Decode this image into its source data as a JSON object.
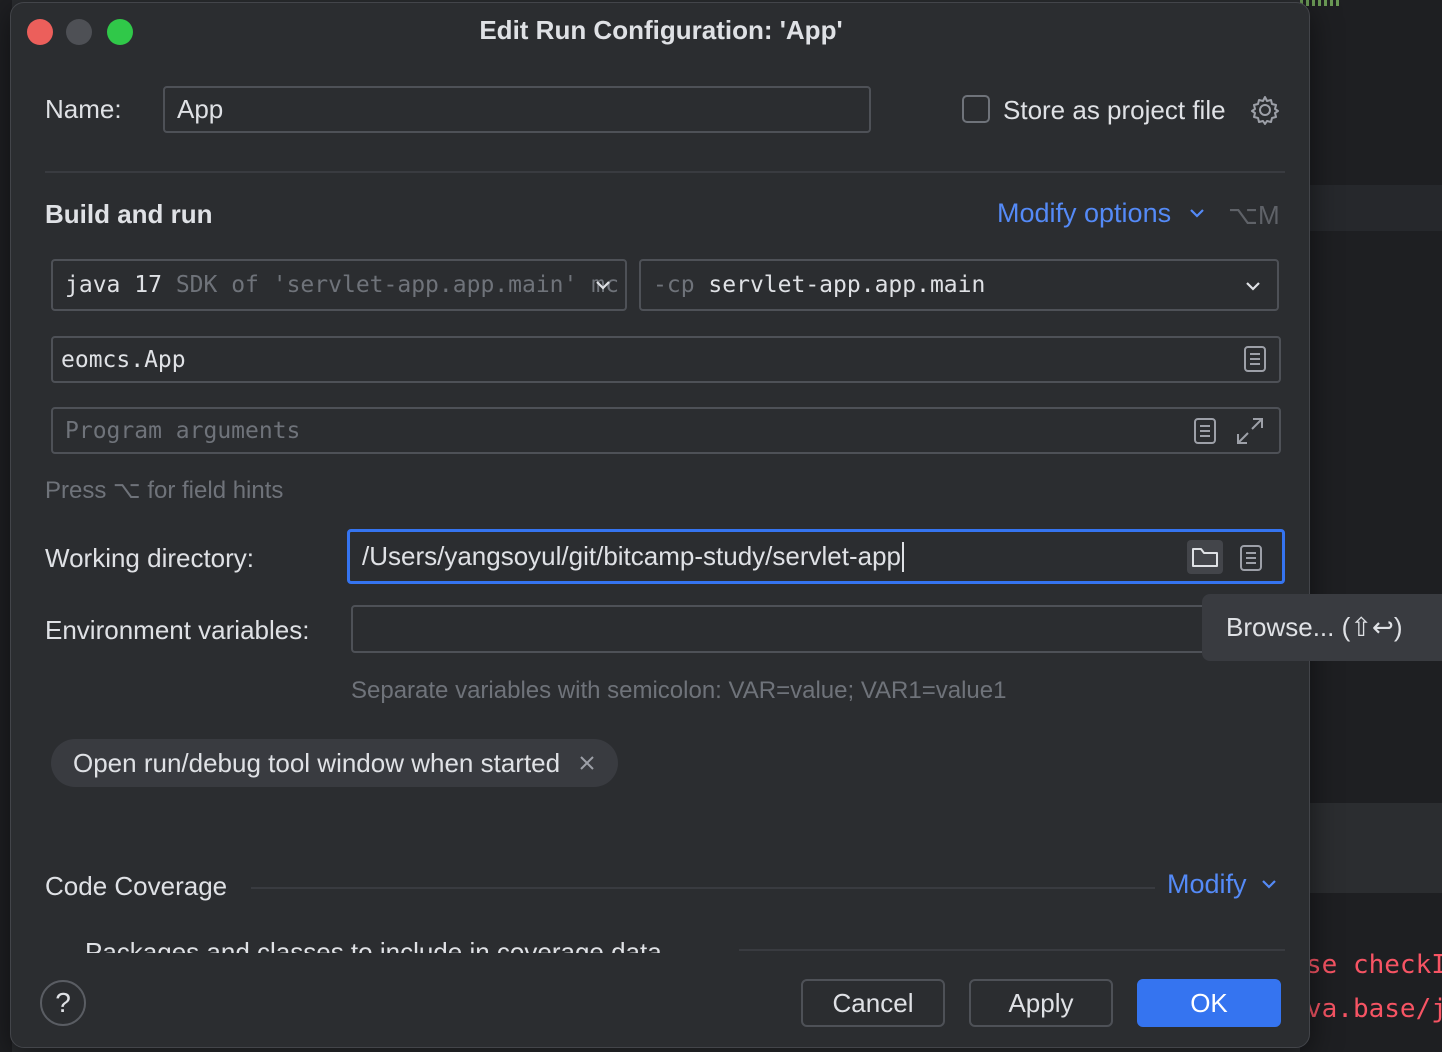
{
  "background": {
    "code_lines": [
      "se checkIl",
      "va.base/ja"
    ]
  },
  "window": {
    "title": "Edit Run Configuration: 'App'"
  },
  "name_row": {
    "label": "Name:",
    "value": "App",
    "store_label": "Store as project file",
    "store_checked": false
  },
  "build_run": {
    "title": "Build and run",
    "modify_options": "Modify options",
    "shortcut": "⌥M",
    "sdk": {
      "java": "java",
      "version": "17",
      "detail": "SDK of 'servlet-app.app.main' mc"
    },
    "classpath": {
      "flag": "-cp",
      "value": "servlet-app.app.main"
    },
    "main_class": "eomcs.App",
    "program_args_placeholder": "Program arguments",
    "field_hint": "Press ⌥ for field hints"
  },
  "working_dir": {
    "label": "Working directory:",
    "value": "/Users/yangsoyul/git/bitcamp-study/servlet-app"
  },
  "env_vars": {
    "label": "Environment variables:",
    "value": "",
    "hint": "Separate variables with semicolon: VAR=value; VAR1=value1"
  },
  "tooltip": "Browse... (⇧↩)",
  "chip": {
    "label": "Open run/debug tool window when started"
  },
  "coverage": {
    "title": "Code Coverage",
    "modify": "Modify",
    "packages_label": "Packages and classes to include in coverage data"
  },
  "footer": {
    "help": "?",
    "cancel": "Cancel",
    "apply": "Apply",
    "ok": "OK"
  },
  "colors": {
    "accent": "#3574f0",
    "link": "#548af7",
    "dialog_bg": "#2b2d30",
    "error_text": "#f75464"
  },
  "icons": [
    "settings-gear-icon",
    "chevron-down-icon",
    "text-edit-icon",
    "expand-icon",
    "folder-icon",
    "close-icon",
    "help-icon"
  ]
}
